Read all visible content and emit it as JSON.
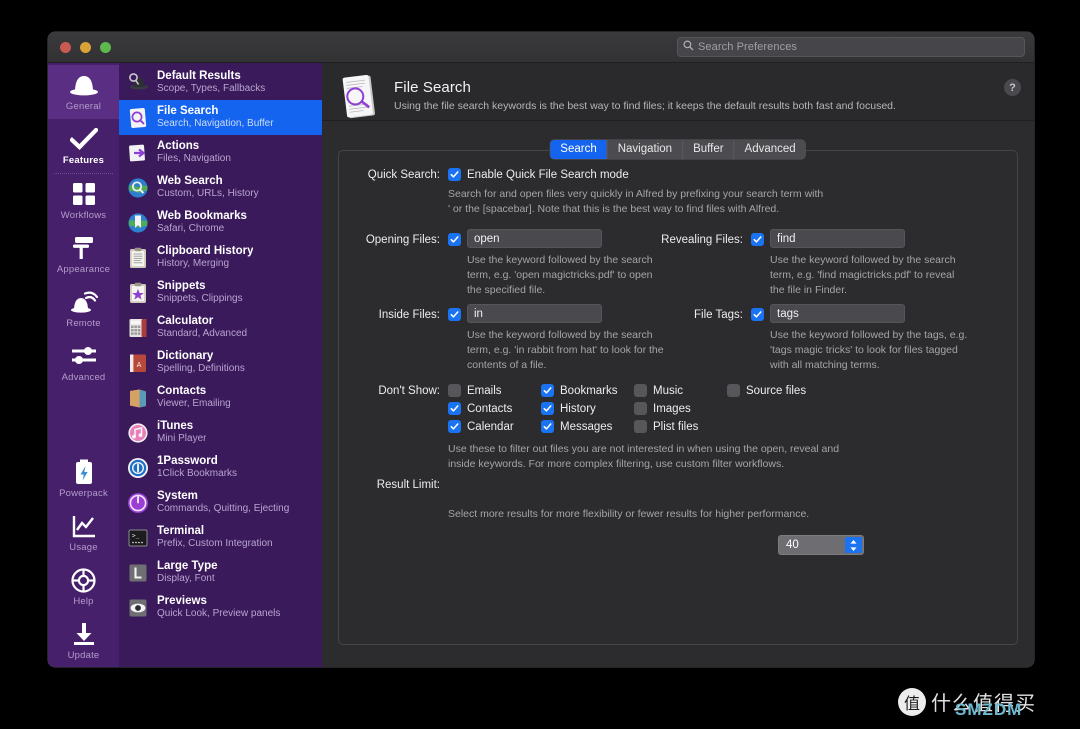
{
  "window": {
    "traffic_lights": [
      "close",
      "minimize",
      "maximize"
    ],
    "search": {
      "placeholder": "Search Preferences",
      "value": "",
      "icon": "search-icon"
    }
  },
  "vertical_nav": {
    "items": [
      {
        "label": "General",
        "icon": "alfred-hat-icon",
        "state": "hover"
      },
      {
        "label": "Features",
        "icon": "checkmark-icon",
        "state": "active"
      },
      {
        "label": "Workflows",
        "icon": "grid-squares-icon",
        "state": "normal"
      },
      {
        "label": "Appearance",
        "icon": "paint-roller-icon",
        "state": "normal"
      },
      {
        "label": "Remote",
        "icon": "remote-waves-icon",
        "state": "normal"
      },
      {
        "label": "Advanced",
        "icon": "sliders-icon",
        "state": "normal"
      },
      {
        "label": "Powerpack",
        "icon": "battery-bolt-icon",
        "state": "normal"
      },
      {
        "label": "Usage",
        "icon": "chart-line-icon",
        "state": "normal"
      },
      {
        "label": "Help",
        "icon": "lifebuoy-icon",
        "state": "normal"
      },
      {
        "label": "Update",
        "icon": "download-arrow-icon",
        "state": "normal"
      }
    ]
  },
  "feature_list": {
    "items": [
      {
        "title": "Default Results",
        "subtitle": "Scope, Types, Fallbacks",
        "icon": "alfred-hat-search-icon",
        "selected": false
      },
      {
        "title": "File Search",
        "subtitle": "Search, Navigation, Buffer",
        "icon": "document-magnifier-icon",
        "selected": true
      },
      {
        "title": "Actions",
        "subtitle": "Files, Navigation",
        "icon": "file-arrow-icon",
        "selected": false
      },
      {
        "title": "Web Search",
        "subtitle": "Custom, URLs, History",
        "icon": "globe-magnifier-icon",
        "selected": false
      },
      {
        "title": "Web Bookmarks",
        "subtitle": "Safari, Chrome",
        "icon": "globe-bookmark-icon",
        "selected": false
      },
      {
        "title": "Clipboard History",
        "subtitle": "History, Merging",
        "icon": "clipboard-icon",
        "selected": false
      },
      {
        "title": "Snippets",
        "subtitle": "Snippets, Clippings",
        "icon": "clipboard-star-icon",
        "selected": false
      },
      {
        "title": "Calculator",
        "subtitle": "Standard, Advanced",
        "icon": "calculator-icon",
        "selected": false
      },
      {
        "title": "Dictionary",
        "subtitle": "Spelling, Definitions",
        "icon": "book-icon",
        "selected": false
      },
      {
        "title": "Contacts",
        "subtitle": "Viewer, Emailing",
        "icon": "address-book-icon",
        "selected": false
      },
      {
        "title": "iTunes",
        "subtitle": "Mini Player",
        "icon": "itunes-note-icon",
        "selected": false
      },
      {
        "title": "1Password",
        "subtitle": "1Click Bookmarks",
        "icon": "onepassword-icon",
        "selected": false
      },
      {
        "title": "System",
        "subtitle": "Commands, Quitting, Ejecting",
        "icon": "power-icon",
        "selected": false
      },
      {
        "title": "Terminal",
        "subtitle": "Prefix, Custom Integration",
        "icon": "terminal-icon",
        "selected": false
      },
      {
        "title": "Large Type",
        "subtitle": "Display, Font",
        "icon": "large-letter-l-icon",
        "selected": false
      },
      {
        "title": "Previews",
        "subtitle": "Quick Look, Preview panels",
        "icon": "eye-icon",
        "selected": false
      }
    ]
  },
  "main": {
    "icon": "document-magnifier-icon",
    "title": "File Search",
    "subtitle": "Using the file search keywords is the best way to find files; it keeps the default results both fast and focused.",
    "help_label": "?",
    "tabs": [
      {
        "label": "Search",
        "active": true
      },
      {
        "label": "Navigation",
        "active": false
      },
      {
        "label": "Buffer",
        "active": false
      },
      {
        "label": "Advanced",
        "active": false
      }
    ],
    "fields": {
      "quick_search": {
        "label": "Quick Search:",
        "checkbox_checked": true,
        "checkbox_label": "Enable Quick File Search mode",
        "help": "Search for and open files very quickly in Alfred by prefixing your search term with\n' or the [spacebar]. Note that this is the best way to find files with Alfred."
      },
      "opening_files": {
        "label": "Opening Files:",
        "checkbox_checked": true,
        "value": "open",
        "help": "Use the keyword followed by the search\nterm, e.g. 'open magictricks.pdf' to open\nthe specified file."
      },
      "revealing_files": {
        "label": "Revealing Files:",
        "checkbox_checked": true,
        "value": "find",
        "help": "Use the keyword followed by the search\nterm, e.g. 'find magictricks.pdf' to reveal\nthe file in Finder."
      },
      "inside_files": {
        "label": "Inside Files:",
        "checkbox_checked": true,
        "value": "in",
        "help": "Use the keyword followed by the search\nterm, e.g. 'in rabbit from hat' to look for the\ncontents of a file."
      },
      "file_tags": {
        "label": "File Tags:",
        "checkbox_checked": true,
        "value": "tags",
        "help": "Use the keyword followed by the tags, e.g.\n'tags magic tricks' to look for files tagged\nwith all matching terms."
      },
      "dont_show": {
        "label": "Don't Show:",
        "columns": [
          [
            {
              "label": "Emails",
              "checked": false
            },
            {
              "label": "Contacts",
              "checked": true
            },
            {
              "label": "Calendar",
              "checked": true
            }
          ],
          [
            {
              "label": "Bookmarks",
              "checked": true
            },
            {
              "label": "History",
              "checked": true
            },
            {
              "label": "Messages",
              "checked": true
            }
          ],
          [
            {
              "label": "Music",
              "checked": false
            },
            {
              "label": "Images",
              "checked": false
            },
            {
              "label": "Plist files",
              "checked": false
            }
          ],
          [
            {
              "label": "Source files",
              "checked": false
            }
          ]
        ],
        "help": "Use these to filter out files you are not interested in when using the open, reveal and\ninside keywords. For more complex filtering, use custom filter workflows."
      },
      "result_limit": {
        "label": "Result Limit:",
        "value": "40",
        "help": "Select more results for more flexibility or fewer results for higher performance."
      }
    }
  },
  "watermark": {
    "logo": "值",
    "text": "什么值得买",
    "sub": "SMZDM"
  },
  "colors": {
    "accent_blue": "#1464f0",
    "sidebar_purple": "#3b1a5c",
    "nav_purple": "#47206b",
    "panel_dark": "#2c2c2e",
    "checkbox_on": "#1a73f2",
    "checkbox_off": "#56565b"
  }
}
